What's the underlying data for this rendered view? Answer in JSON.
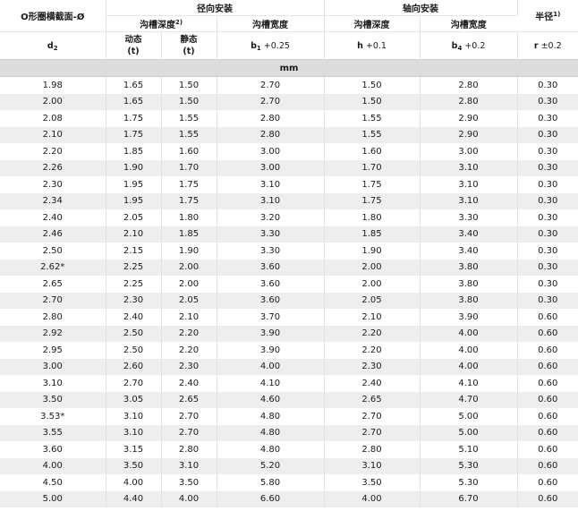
{
  "header": {
    "col_oring": "O形圈横截面-Ø",
    "radial_group": "径向安装",
    "axial_group": "轴向安装",
    "radius_label": "半径",
    "radius_sup": "1)",
    "groove_depth_label": "沟槽深度",
    "groove_depth_sup": "2)",
    "groove_width_label": "沟槽宽度",
    "axial_depth_label": "沟槽深度",
    "axial_width_label": "沟槽宽度",
    "d2_main": "d",
    "d2_sub": "2",
    "dynamic_label": "动态",
    "dynamic_unit": "(t)",
    "static_label": "静态",
    "static_unit": "(t)",
    "b1_main": "b",
    "b1_sub": "1",
    "b1_tol": " +0.25",
    "h_main": "h",
    "h_tol": " +0.1",
    "b4_main": "b",
    "b4_sub": "4",
    "b4_tol": " +0.2",
    "r_main": "r",
    "r_tol": " ±0.2",
    "unit": "mm"
  },
  "rows": [
    [
      "1.98",
      "1.65",
      "1.50",
      "2.70",
      "1.50",
      "2.80",
      "0.30"
    ],
    [
      "2.00",
      "1.65",
      "1.50",
      "2.70",
      "1.50",
      "2.80",
      "0.30"
    ],
    [
      "2.08",
      "1.75",
      "1.55",
      "2.80",
      "1.55",
      "2.90",
      "0.30"
    ],
    [
      "2.10",
      "1.75",
      "1.55",
      "2.80",
      "1.55",
      "2.90",
      "0.30"
    ],
    [
      "2.20",
      "1.85",
      "1.60",
      "3.00",
      "1.60",
      "3.00",
      "0.30"
    ],
    [
      "2.26",
      "1.90",
      "1.70",
      "3.00",
      "1.70",
      "3.10",
      "0.30"
    ],
    [
      "2.30",
      "1.95",
      "1.75",
      "3.10",
      "1.75",
      "3.10",
      "0.30"
    ],
    [
      "2.34",
      "1.95",
      "1.75",
      "3.10",
      "1.75",
      "3.10",
      "0.30"
    ],
    [
      "2.40",
      "2.05",
      "1.80",
      "3.20",
      "1.80",
      "3.30",
      "0.30"
    ],
    [
      "2.46",
      "2.10",
      "1.85",
      "3.30",
      "1.85",
      "3.40",
      "0.30"
    ],
    [
      "2.50",
      "2.15",
      "1.90",
      "3.30",
      "1.90",
      "3.40",
      "0.30"
    ],
    [
      "2.62*",
      "2.25",
      "2.00",
      "3.60",
      "2.00",
      "3.80",
      "0.30"
    ],
    [
      "2.65",
      "2.25",
      "2.00",
      "3.60",
      "2.00",
      "3.80",
      "0.30"
    ],
    [
      "2.70",
      "2.30",
      "2.05",
      "3.60",
      "2.05",
      "3.80",
      "0.30"
    ],
    [
      "2.80",
      "2.40",
      "2.10",
      "3.70",
      "2.10",
      "3.90",
      "0.60"
    ],
    [
      "2.92",
      "2.50",
      "2.20",
      "3.90",
      "2.20",
      "4.00",
      "0.60"
    ],
    [
      "2.95",
      "2.50",
      "2.20",
      "3.90",
      "2.20",
      "4.00",
      "0.60"
    ],
    [
      "3.00",
      "2.60",
      "2.30",
      "4.00",
      "2.30",
      "4.00",
      "0.60"
    ],
    [
      "3.10",
      "2.70",
      "2.40",
      "4.10",
      "2.40",
      "4.10",
      "0.60"
    ],
    [
      "3.50",
      "3.05",
      "2.65",
      "4.60",
      "2.65",
      "4.70",
      "0.60"
    ],
    [
      "3.53*",
      "3.10",
      "2.70",
      "4.80",
      "2.70",
      "5.00",
      "0.60"
    ],
    [
      "3.55",
      "3.10",
      "2.70",
      "4.80",
      "2.70",
      "5.00",
      "0.60"
    ],
    [
      "3.60",
      "3.15",
      "2.80",
      "4.80",
      "2.80",
      "5.10",
      "0.60"
    ],
    [
      "4.00",
      "3.50",
      "3.10",
      "5.20",
      "3.10",
      "5.30",
      "0.60"
    ],
    [
      "4.50",
      "4.00",
      "3.50",
      "5.80",
      "3.50",
      "5.30",
      "0.60"
    ],
    [
      "5.00",
      "4.40",
      "4.00",
      "6.60",
      "4.00",
      "6.70",
      "0.60"
    ]
  ]
}
